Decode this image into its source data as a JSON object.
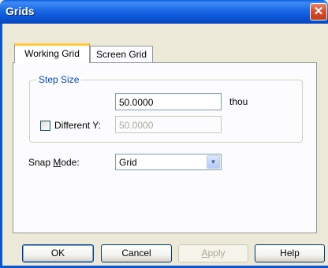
{
  "window": {
    "title": "Grids"
  },
  "tabs": [
    {
      "label": "Working Grid",
      "active": true
    },
    {
      "label": "Screen Grid",
      "active": false
    }
  ],
  "step_size": {
    "label": "Step Size",
    "value": "50.0000",
    "unit": "thou",
    "different_y_label": "Different Y:",
    "different_y_checked": false,
    "y_value": "50.0000"
  },
  "snap_mode": {
    "label_prefix": "Snap ",
    "label_underlined": "M",
    "label_suffix": "ode:",
    "value": "Grid"
  },
  "buttons": {
    "ok": "OK",
    "cancel": "Cancel",
    "apply_underlined": "A",
    "apply_rest": "pply",
    "help": "Help"
  },
  "colors": {
    "title_bar": "#0a55d4",
    "dialog_bg": "#ece9d8",
    "group_label": "#0046d5",
    "active_tab_accent": "#ffc83c"
  },
  "icons": {
    "close": "close-icon",
    "dropdown": "chevron-down-icon"
  }
}
